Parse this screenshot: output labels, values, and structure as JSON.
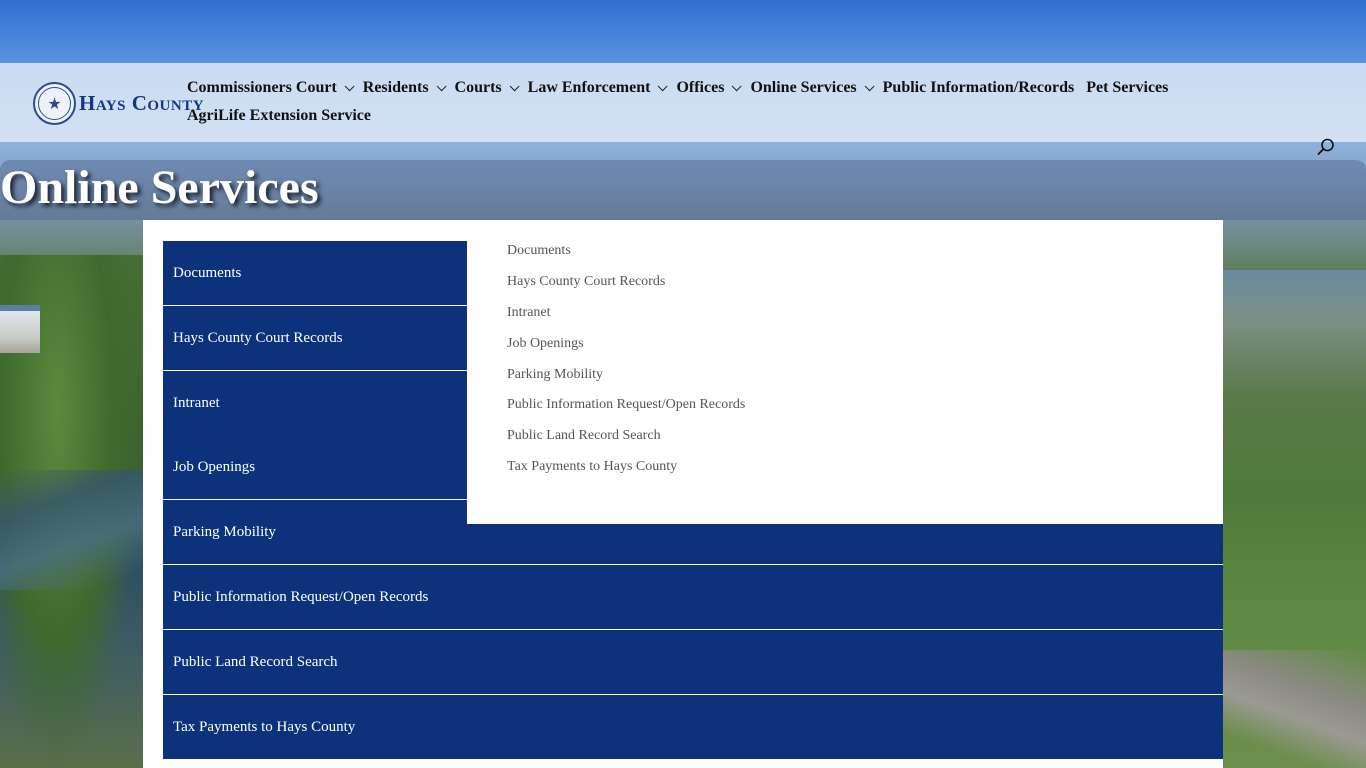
{
  "brand": {
    "logo_text": "Hays County",
    "seal_icon": "star-seal-icon"
  },
  "nav": {
    "items": [
      {
        "label": "Commissioners Court",
        "has_dropdown": true
      },
      {
        "label": "Residents",
        "has_dropdown": true
      },
      {
        "label": "Courts",
        "has_dropdown": true
      },
      {
        "label": "Law Enforcement",
        "has_dropdown": true
      },
      {
        "label": "Offices",
        "has_dropdown": true
      },
      {
        "label": "Online Services",
        "has_dropdown": true
      },
      {
        "label": "Public Information/Records",
        "has_dropdown": false
      },
      {
        "label": "Pet Services",
        "has_dropdown": false
      },
      {
        "label": "AgriLife Extension Service",
        "has_dropdown": false
      }
    ],
    "search_icon": "search-icon"
  },
  "page": {
    "title": "Online Services"
  },
  "services": {
    "buttons": [
      "Documents",
      "Hays County Court Records",
      "Intranet",
      "Job Openings",
      "Parking Mobility",
      "Public Information Request/Open Records",
      "Public Land Record Search",
      "Tax Payments to Hays County"
    ],
    "links": [
      "Documents",
      "Hays County Court Records",
      "Intranet",
      "Job Openings",
      "Parking Mobility",
      "Public Information Request/Open Records",
      "Public Land Record Search",
      "Tax Payments to Hays County"
    ]
  },
  "colors": {
    "button_bg": "#0b327a",
    "button_text": "#ffffff",
    "link_text": "#555555",
    "logo_text": "#16377a"
  }
}
